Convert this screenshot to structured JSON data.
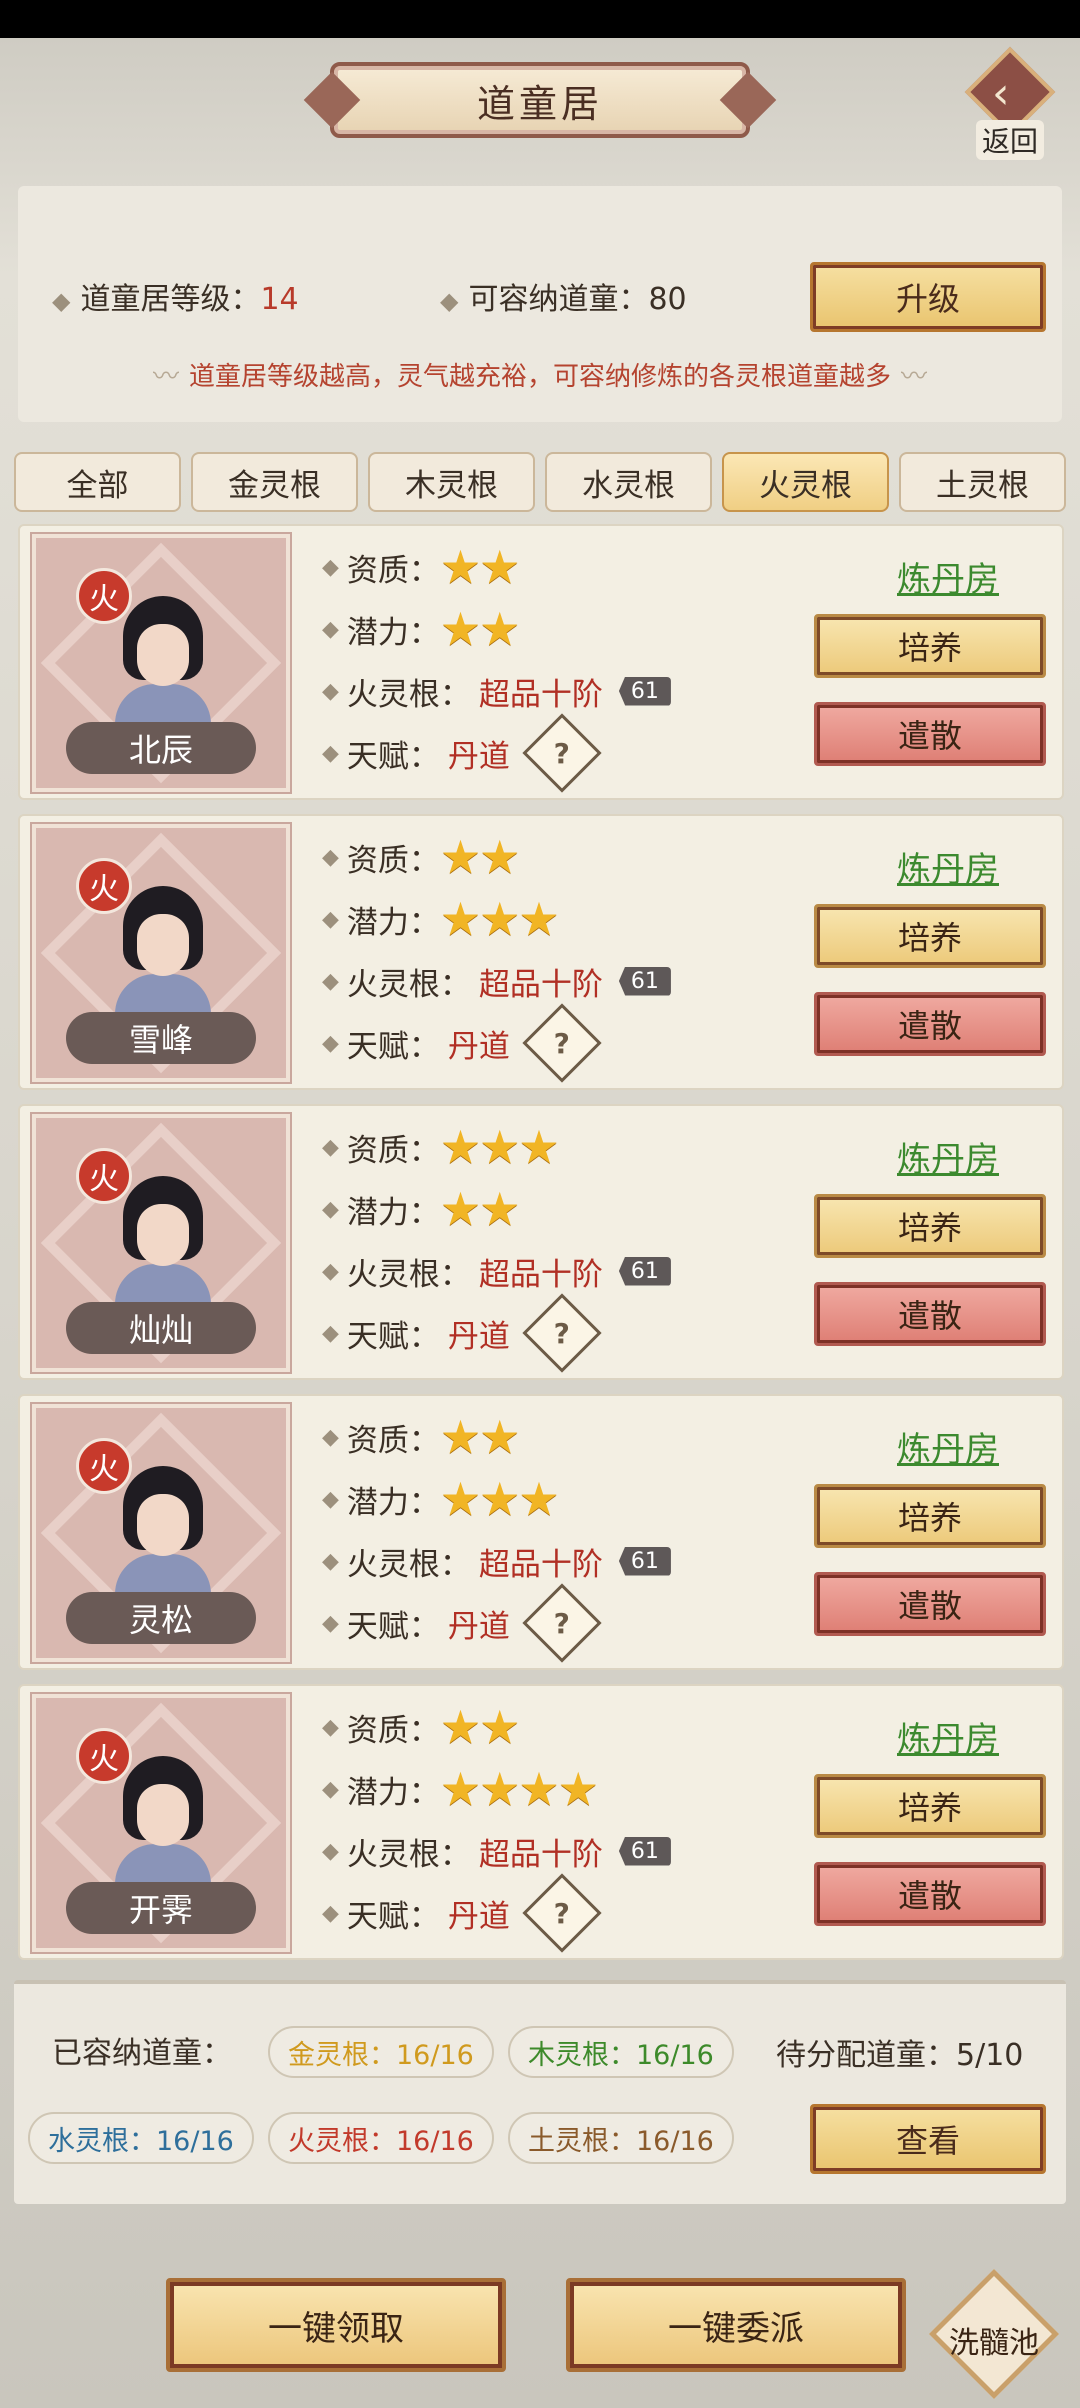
{
  "header": {
    "title": "道童居",
    "back_label": "返回"
  },
  "info": {
    "level_label": "道童居等级：",
    "level_value": "14",
    "capacity_label": "可容纳道童：",
    "capacity_value": "80",
    "upgrade_label": "升级",
    "hint": "道童居等级越高，灵气越充裕，可容纳修炼的各灵根道童越多"
  },
  "tabs": [
    {
      "label": "全部"
    },
    {
      "label": "金灵根"
    },
    {
      "label": "木灵根"
    },
    {
      "label": "水灵根"
    },
    {
      "label": "火灵根",
      "active": true
    },
    {
      "label": "土灵根"
    }
  ],
  "card_labels": {
    "aptitude": "资质：",
    "potential": "潜力：",
    "root": "火灵根：",
    "talent": "天赋：",
    "train": "培养",
    "dismiss": "遣散"
  },
  "cards": [
    {
      "element": "火",
      "name": "北辰",
      "aptitude_stars": 2,
      "potential_stars": 2,
      "root_value": "超品十阶",
      "root_level": "61",
      "talent": "丹道",
      "talent_icon": "?",
      "room": "炼丹房"
    },
    {
      "element": "火",
      "name": "雪峰",
      "aptitude_stars": 2,
      "potential_stars": 3,
      "root_value": "超品十阶",
      "root_level": "61",
      "talent": "丹道",
      "talent_icon": "?",
      "room": "炼丹房"
    },
    {
      "element": "火",
      "name": "灿灿",
      "aptitude_stars": 3,
      "potential_stars": 2,
      "root_value": "超品十阶",
      "root_level": "61",
      "talent": "丹道",
      "talent_icon": "?",
      "room": "炼丹房"
    },
    {
      "element": "火",
      "name": "灵松",
      "aptitude_stars": 2,
      "potential_stars": 3,
      "root_value": "超品十阶",
      "root_level": "61",
      "talent": "丹道",
      "talent_icon": "?",
      "room": "炼丹房"
    },
    {
      "element": "火",
      "name": "开霁",
      "aptitude_stars": 2,
      "potential_stars": 4,
      "root_value": "超品十阶",
      "root_level": "61",
      "talent": "丹道",
      "talent_icon": "?",
      "room": "炼丹房"
    }
  ],
  "summary": {
    "label": "已容纳道童：",
    "gold": "金灵根：16/16",
    "wood": "木灵根：16/16",
    "water": "水灵根：16/16",
    "fire": "火灵根：16/16",
    "earth": "土灵根：16/16",
    "pending": "待分配道童：5/10",
    "view_label": "查看"
  },
  "bottom": {
    "claim_all": "一键领取",
    "dispatch_all": "一键委派",
    "pool": "洗髓池"
  },
  "colors": {
    "accent_red": "#b12f24",
    "star": "#f1b525",
    "link_green": "#3c8a2f",
    "fire_badge": "#c73a2c"
  }
}
